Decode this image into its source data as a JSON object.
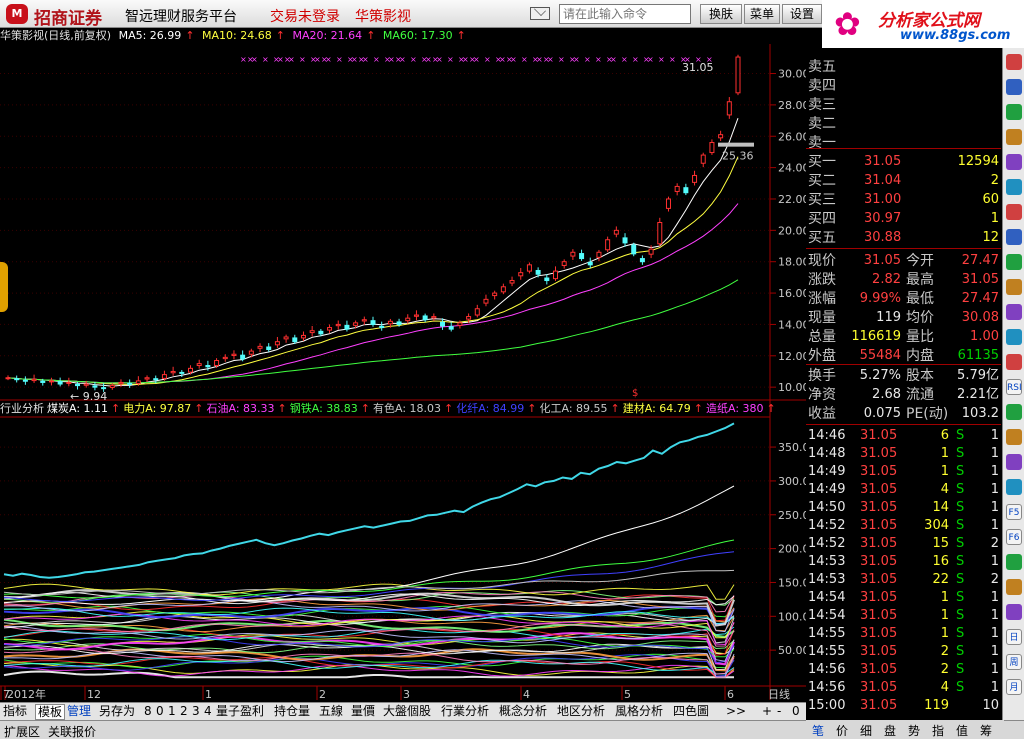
{
  "topbar": {
    "logo_badge": "M",
    "brand": "招商证券",
    "app_title": "智远理财服务平台",
    "trade_status": "交易未登录",
    "stock_name": "华策影视",
    "search_placeholder": "请在此输入命令",
    "buttons": [
      "换肤",
      "菜单",
      "设置"
    ],
    "ad_title": "分析家公式网",
    "ad_url": "www.88gs.com"
  },
  "chart": {
    "title": "华策影视(日线,前复权)",
    "ma": [
      {
        "label": "MA5: 26.99",
        "color": "#ffffff"
      },
      {
        "label": "MA10: 24.68",
        "color": "#ffff40"
      },
      {
        "label": "MA20: 21.64",
        "color": "#ff40ff"
      },
      {
        "label": "MA60: 17.30",
        "color": "#40ff40"
      }
    ],
    "high_label": "31.05",
    "low_label": "9.94",
    "mark_label": "25.36",
    "y_ticks": [
      "30.00",
      "28.00",
      "26.00",
      "24.00",
      "22.00",
      "20.00",
      "18.00",
      "16.00",
      "14.00",
      "12.00",
      "10.00"
    ]
  },
  "chart_data": {
    "type": "candlestick",
    "title": "华策影视(日线,前复权)",
    "ylim": [
      9.5,
      31.5
    ],
    "closes": [
      10.6,
      10.5,
      10.4,
      10.5,
      10.3,
      10.4,
      10.2,
      10.3,
      10.1,
      10.2,
      10.0,
      9.95,
      10.1,
      10.3,
      10.2,
      10.4,
      10.6,
      10.5,
      10.8,
      11.0,
      10.9,
      11.2,
      11.5,
      11.3,
      11.7,
      11.9,
      12.1,
      11.8,
      12.3,
      12.6,
      12.4,
      12.9,
      13.2,
      12.9,
      13.3,
      13.6,
      13.4,
      13.8,
      14.0,
      13.7,
      14.1,
      14.3,
      14.0,
      13.8,
      14.2,
      14.0,
      14.4,
      14.6,
      14.3,
      14.5,
      13.9,
      13.7,
      14.1,
      14.5,
      15.0,
      15.6,
      16.0,
      16.4,
      16.8,
      17.3,
      17.8,
      17.2,
      16.8,
      17.4,
      18.0,
      18.6,
      18.2,
      17.8,
      18.6,
      19.4,
      20.0,
      19.2,
      18.5,
      18.0,
      18.8,
      20.5,
      22.0,
      22.8,
      22.4,
      23.5,
      24.8,
      25.6,
      26.1,
      28.2,
      31.05
    ],
    "ma5_last": 26.99,
    "ma10_last": 24.68,
    "ma20_last": 21.64,
    "ma60_last": 17.3,
    "x_labels": [
      "2012年",
      "12",
      "1",
      "2",
      "3",
      "4",
      "5",
      "6",
      "7"
    ],
    "indicator": {
      "title": "行业分析",
      "series": [
        {
          "name": "煤炭A",
          "last": 1.11,
          "color": "#ffffff"
        },
        {
          "name": "电力A",
          "last": 97.87,
          "color": "#ffff40"
        },
        {
          "name": "石油A",
          "last": 83.33,
          "color": "#ff40ff"
        },
        {
          "name": "钢铁A",
          "last": 38.83,
          "color": "#40ff40"
        },
        {
          "name": "有色A",
          "last": 18.03,
          "color": "#c8c8c8"
        },
        {
          "name": "化纤A",
          "last": 84.99,
          "color": "#4040ff"
        },
        {
          "name": "化工A",
          "last": 89.55,
          "color": "#c8c8c8"
        },
        {
          "name": "建材A",
          "last": 64.79,
          "color": "#ffff40"
        },
        {
          "name": "造纸A",
          "last": 380,
          "color": "#ff40ff"
        }
      ],
      "y_ticks": [
        "350.00",
        "300.00",
        "250.00",
        "200.00",
        "150.00",
        "100.00",
        "50.00"
      ],
      "ylim": [
        0,
        390
      ],
      "leader": [
        162,
        160,
        163,
        161,
        158,
        157,
        158,
        160,
        162,
        165,
        166,
        168,
        170,
        172,
        174,
        176,
        180,
        182,
        184,
        186,
        190,
        192,
        193,
        197,
        200,
        204,
        207,
        210,
        213,
        208,
        205,
        208,
        212,
        215,
        219,
        222,
        220,
        224,
        227,
        230,
        233,
        231,
        234,
        237,
        240,
        241,
        245,
        249,
        250,
        253,
        256,
        254,
        262,
        268,
        273,
        276,
        282,
        288,
        295,
        292,
        298,
        300,
        305,
        303,
        312,
        310,
        318,
        322,
        328,
        326,
        330,
        334,
        345,
        340,
        350,
        357,
        360,
        365,
        368,
        373,
        378,
        385
      ]
    }
  },
  "quote": {
    "sell": [
      {
        "label": "卖五",
        "price": "",
        "vol": ""
      },
      {
        "label": "卖四",
        "price": "",
        "vol": ""
      },
      {
        "label": "卖三",
        "price": "",
        "vol": ""
      },
      {
        "label": "卖二",
        "price": "",
        "vol": ""
      },
      {
        "label": "卖一",
        "price": "",
        "vol": ""
      }
    ],
    "buy": [
      {
        "label": "买一",
        "price": "31.05",
        "vol": "12594"
      },
      {
        "label": "买二",
        "price": "31.04",
        "vol": "2"
      },
      {
        "label": "买三",
        "price": "31.00",
        "vol": "60"
      },
      {
        "label": "买四",
        "price": "30.97",
        "vol": "1"
      },
      {
        "label": "买五",
        "price": "30.88",
        "vol": "12"
      }
    ],
    "stats": [
      {
        "l1": "现价",
        "v1": "31.05",
        "c1": "red",
        "l2": "今开",
        "v2": "27.47",
        "c2": "red"
      },
      {
        "l1": "涨跌",
        "v1": "2.82",
        "c1": "red",
        "l2": "最高",
        "v2": "31.05",
        "c2": "red"
      },
      {
        "l1": "涨幅",
        "v1": "9.99%",
        "c1": "red",
        "l2": "最低",
        "v2": "27.47",
        "c2": "red"
      },
      {
        "l1": "现量",
        "v1": "119",
        "c1": "wht",
        "l2": "均价",
        "v2": "30.08",
        "c2": "red"
      },
      {
        "l1": "总量",
        "v1": "116619",
        "c1": "yel",
        "l2": "量比",
        "v2": "1.00",
        "c2": "red"
      },
      {
        "l1": "外盘",
        "v1": "55484",
        "c1": "red",
        "l2": "内盘",
        "v2": "61135",
        "c2": "grn"
      }
    ],
    "stats2": [
      {
        "l1": "换手",
        "v1": "5.27%",
        "l2": "股本",
        "v2": "5.79亿"
      },
      {
        "l1": "净资",
        "v1": "2.68",
        "l2": "流通",
        "v2": "2.21亿"
      },
      {
        "l1": "收益",
        "v1": "0.075",
        "l2": "PE(动)",
        "v2": "103.2"
      }
    ],
    "ticks": [
      {
        "t": "14:46",
        "p": "31.05",
        "v": "6",
        "bs": "S",
        "n": "1"
      },
      {
        "t": "14:48",
        "p": "31.05",
        "v": "1",
        "bs": "S",
        "n": "1"
      },
      {
        "t": "14:49",
        "p": "31.05",
        "v": "1",
        "bs": "S",
        "n": "1"
      },
      {
        "t": "14:49",
        "p": "31.05",
        "v": "4",
        "bs": "S",
        "n": "1"
      },
      {
        "t": "14:50",
        "p": "31.05",
        "v": "14",
        "bs": "S",
        "n": "1"
      },
      {
        "t": "14:52",
        "p": "31.05",
        "v": "304",
        "bs": "S",
        "n": "1"
      },
      {
        "t": "14:52",
        "p": "31.05",
        "v": "15",
        "bs": "S",
        "n": "2"
      },
      {
        "t": "14:53",
        "p": "31.05",
        "v": "16",
        "bs": "S",
        "n": "1"
      },
      {
        "t": "14:53",
        "p": "31.05",
        "v": "22",
        "bs": "S",
        "n": "2"
      },
      {
        "t": "14:54",
        "p": "31.05",
        "v": "1",
        "bs": "S",
        "n": "1"
      },
      {
        "t": "14:54",
        "p": "31.05",
        "v": "1",
        "bs": "S",
        "n": "1"
      },
      {
        "t": "14:55",
        "p": "31.05",
        "v": "1",
        "bs": "S",
        "n": "1"
      },
      {
        "t": "14:55",
        "p": "31.05",
        "v": "2",
        "bs": "S",
        "n": "1"
      },
      {
        "t": "14:56",
        "p": "31.05",
        "v": "2",
        "bs": "S",
        "n": "1"
      },
      {
        "t": "14:56",
        "p": "31.05",
        "v": "4",
        "bs": "S",
        "n": "1"
      },
      {
        "t": "15:00",
        "p": "31.05",
        "v": "119",
        "bs": "",
        "n": "10"
      }
    ]
  },
  "bottombar": {
    "tabs": [
      "指标",
      "模板",
      "管理",
      "另存为",
      "8",
      "0",
      "1",
      "2",
      "3",
      "4",
      "量子盈利",
      "持仓量",
      "五線",
      "量價",
      "大盤個股",
      "行業分析",
      "概念分析",
      "地区分析",
      "風格分析",
      "四色圖"
    ],
    "period": "日线",
    "more": ">>",
    "plus": "+",
    "minus": "-",
    "zero": "0"
  },
  "statusbar": {
    "items": [
      "扩展区",
      "关联报价"
    ]
  },
  "rtabs": [
    "笔",
    "价",
    "细",
    "盘",
    "势",
    "指",
    "值",
    "筹"
  ],
  "rtoolbar": [
    "RSI",
    "F5",
    "F6",
    "日",
    "周",
    "月"
  ]
}
